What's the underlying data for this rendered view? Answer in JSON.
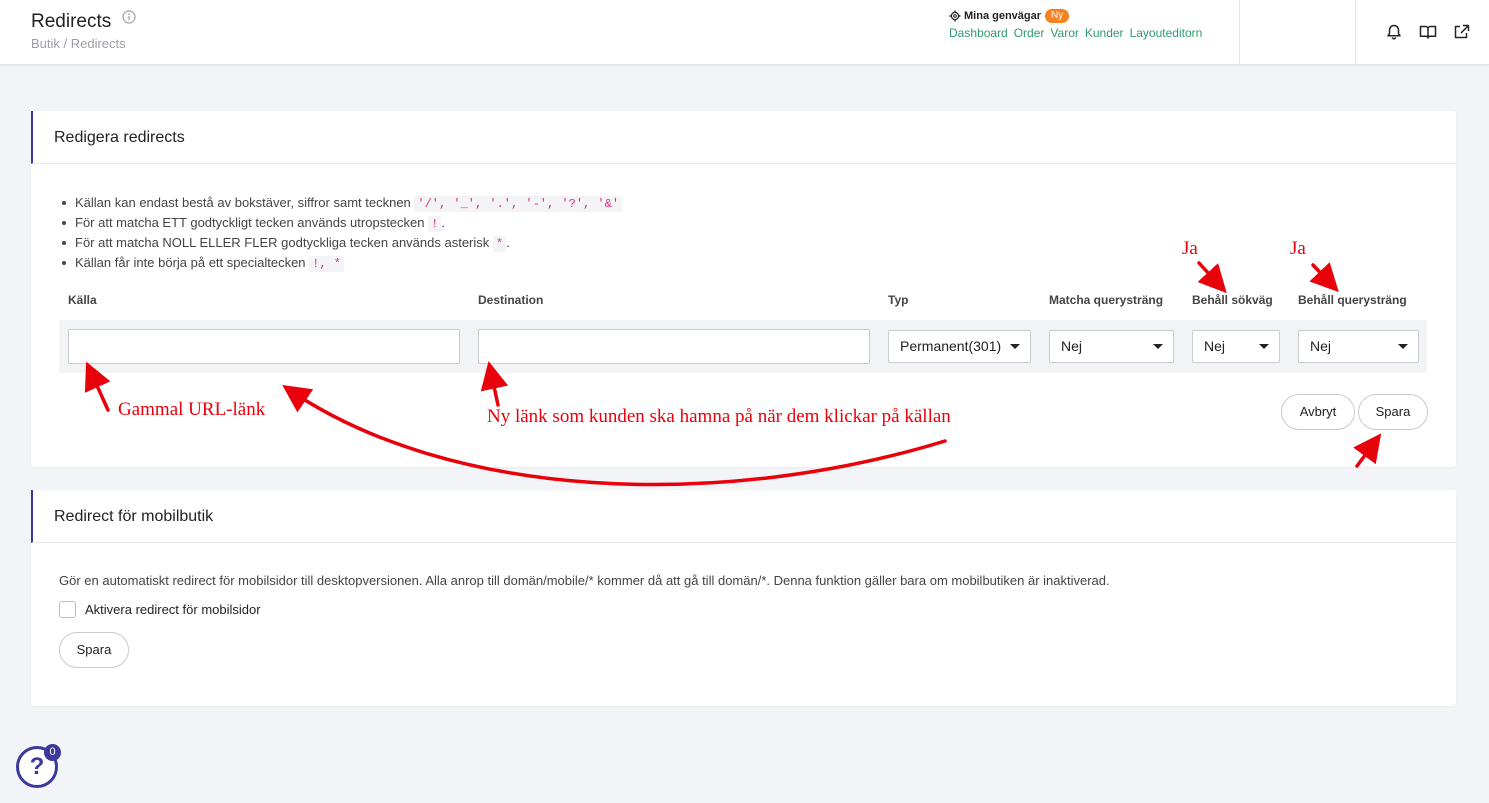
{
  "header": {
    "title": "Redirects",
    "breadcrumb": "Butik / Redirects",
    "shortcuts_label": "Mina genvägar",
    "shortcuts_badge": "Ny",
    "shortcut_links": [
      "Dashboard",
      "Order",
      "Varor",
      "Kunder",
      "Layouteditorn"
    ]
  },
  "edit_card": {
    "title": "Redigera redirects",
    "rules": [
      {
        "text": "Källan kan endast bestå av bokstäver, siffror samt tecknen ",
        "code": "'/', '_', '.', '-', '?', '&'",
        "suffix": ""
      },
      {
        "text": "För att matcha ETT godtyckligt tecken används utropstecken ",
        "code": "!",
        "suffix": "."
      },
      {
        "text": "För att matcha NOLL ELLER FLER godtyckliga tecken används asterisk ",
        "code": "*",
        "suffix": "."
      },
      {
        "text": "Källan får inte börja på ett specialtecken ",
        "code": "!, *",
        "suffix": ""
      }
    ],
    "columns": {
      "source": "Källa",
      "destination": "Destination",
      "type": "Typ",
      "match_query": "Matcha querysträng",
      "keep_path": "Behåll sökväg",
      "keep_query": "Behåll querysträng"
    },
    "row": {
      "source_value": "",
      "destination_value": "",
      "type_value": "Permanent(301)",
      "match_query_value": "Nej",
      "keep_path_value": "Nej",
      "keep_query_value": "Nej"
    },
    "cancel_label": "Avbryt",
    "save_label": "Spara"
  },
  "mobile_card": {
    "title": "Redirect för mobilbutik",
    "description": "Gör en automatiskt redirect för mobilsidor till desktopversionen. Alla anrop till domän/mobile/* kommer då att gå till domän/*. Denna funktion gäller bara om mobilbutiken är inaktiverad.",
    "checkbox_label": "Aktivera redirect för mobilsidor",
    "checkbox_checked": false,
    "save_label": "Spara"
  },
  "help": {
    "icon": "question-icon",
    "badge_count": "0"
  },
  "annotations": {
    "ja_path": "Ja",
    "ja_query": "Ja",
    "old_url": "Gammal URL-länk",
    "new_link": "Ny länk som kunden ska hamna på när dem klickar på källan",
    "color": "#e8000b"
  }
}
